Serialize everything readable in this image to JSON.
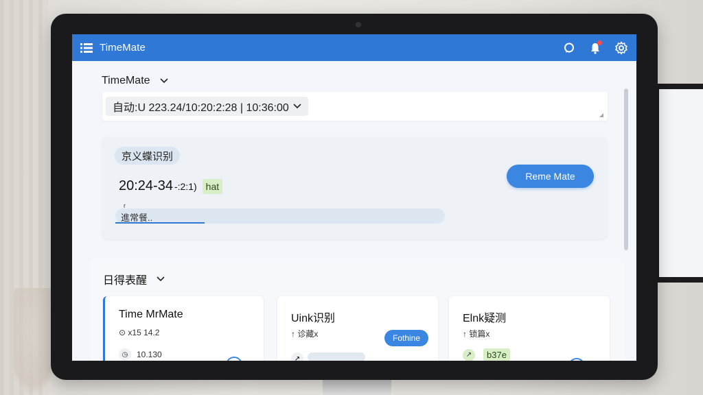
{
  "app": {
    "title": "TimeMate"
  },
  "header": {
    "title": "TimeMate",
    "date_value": "自动:U 223.24/10:20:2:28 | 10:36:00"
  },
  "recognition": {
    "pill_label": "京义蝶识别",
    "time_main": "20:24-34",
    "time_suffix": "-:2:1)",
    "tag": "hat",
    "progress_label": "進常餐..",
    "progress_mark": "r",
    "progress_fraction": 0.27,
    "action_label": "Reme Mate"
  },
  "reminders": {
    "title": "日得表醒",
    "tiles": [
      {
        "title": "Time MrMate",
        "sub": "⊙ x15 14.2",
        "foot": "10.130"
      },
      {
        "title": "Uink识别",
        "sub": "↑ 诊藏x",
        "button": "Fothine"
      },
      {
        "title": "Elnk疑测",
        "sub": "↑ 锁篇x",
        "tag": "b37e"
      }
    ]
  },
  "colors": {
    "accent": "#2f78d6",
    "notification": "#ff4b4b",
    "tag_green": "#d7eec7"
  },
  "icons": [
    "menu-icon",
    "chat-icon",
    "bell-icon",
    "gear-icon",
    "chevron-down-icon",
    "clock-icon",
    "arrow-up-icon"
  ]
}
